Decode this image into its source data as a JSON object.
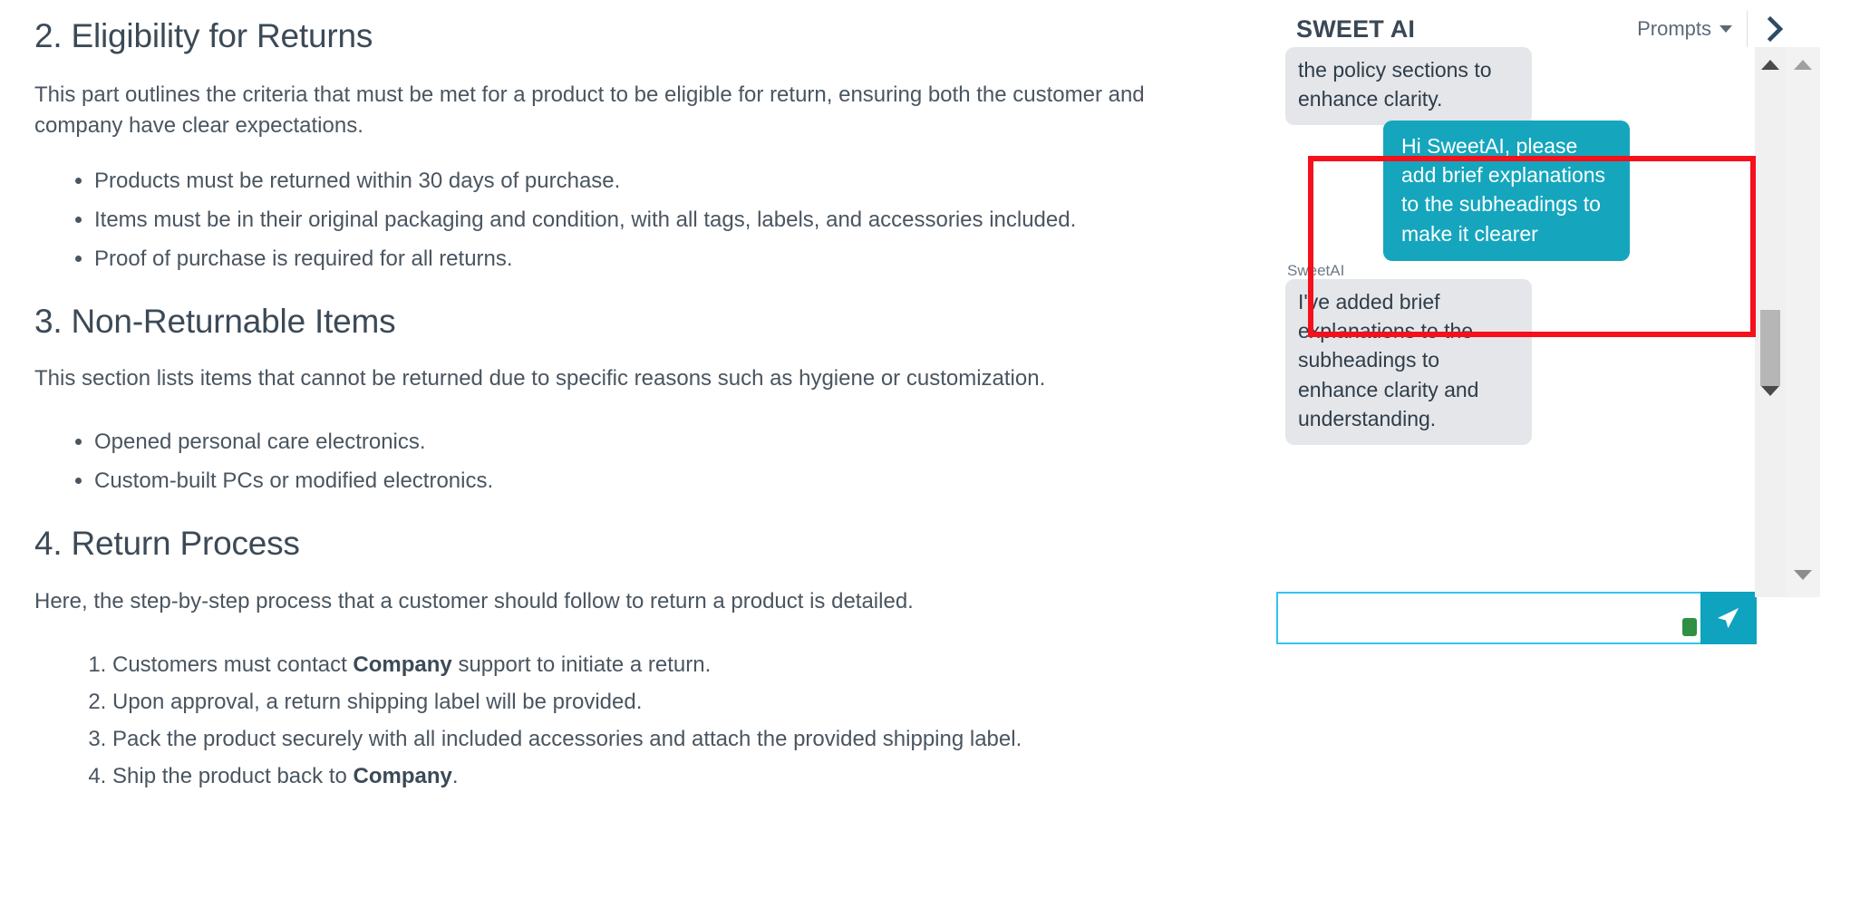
{
  "document": {
    "sections": [
      {
        "heading": "2. Eligibility for Returns",
        "paragraph": "This part outlines the criteria that must be met for a product to be eligible for return, ensuring both the customer and company have clear expectations.",
        "list_type": "bullet",
        "items": [
          "Products must be returned within 30 days of purchase.",
          "Items must be in their original packaging and condition, with all tags, labels, and accessories included.",
          "Proof of purchase is required for all returns."
        ]
      },
      {
        "heading": "3. Non-Returnable Items",
        "paragraph": "This section lists items that cannot be returned due to specific reasons such as hygiene or customization.",
        "list_type": "bullet",
        "items": [
          "Opened personal care electronics.",
          "Custom-built PCs or modified electronics."
        ]
      },
      {
        "heading": "4. Return Process",
        "paragraph": "Here, the step-by-step process that a customer should follow to return a product is detailed.",
        "list_type": "number",
        "items_rich": [
          {
            "pre": "Customers must contact ",
            "strong": "Company",
            "post": " support to initiate a return."
          },
          {
            "pre": "Upon approval, a return shipping label will be provided.",
            "strong": "",
            "post": ""
          },
          {
            "pre": "Pack the product securely with all included accessories and attach the provided shipping label.",
            "strong": "",
            "post": ""
          },
          {
            "pre": "Ship the product back to ",
            "strong": "Company",
            "post": "."
          }
        ]
      }
    ]
  },
  "chat": {
    "title": "SWEET AI",
    "prompts_label": "Prompts",
    "collapse_icon": "chevron-right-icon",
    "caret_icon": "chevron-down-icon",
    "messages": [
      {
        "role": "assistant",
        "sender": "",
        "text": "the policy sections to enhance clarity."
      },
      {
        "role": "user",
        "sender": "",
        "text": "Hi SweetAI, please add brief explanations to the subheadings to make it clearer"
      },
      {
        "role": "assistant",
        "sender": "SweetAI",
        "text": "I've added brief explanations to the subheadings to enhance clarity and understanding."
      }
    ],
    "input": {
      "value": "",
      "placeholder": ""
    },
    "send_icon": "send-paper-plane-icon",
    "resize_handle": "resize-handle"
  },
  "annotation": {
    "color": "#f5101b",
    "target": "user-message-bubble"
  },
  "colors": {
    "accent_teal": "#15a6bd",
    "send_button": "#0fa3c0",
    "bot_bubble": "#e4e6e9",
    "input_border": "#2ec6ef",
    "heading": "#3c4a57",
    "body_text": "#4a5560",
    "annotation_red": "#f5101b",
    "status_green": "#2f8f42"
  }
}
